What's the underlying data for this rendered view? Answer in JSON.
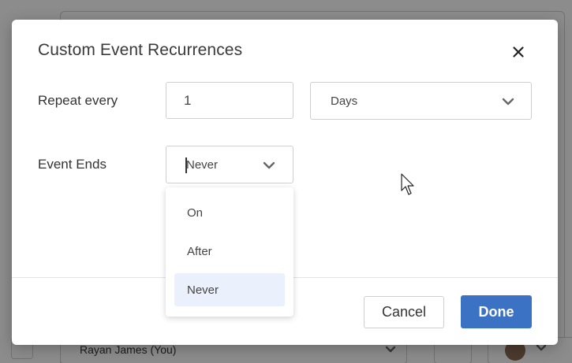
{
  "background": {
    "row_text": "Rayan James (You)"
  },
  "modal": {
    "title": "Custom Event Recurrences",
    "close_icon": "close-icon",
    "repeat_label": "Repeat every",
    "repeat_value": "1",
    "unit_value": "Days",
    "ends_label": "Event Ends",
    "ends_value": "Never",
    "ends_options": [
      "On",
      "After",
      "Never"
    ],
    "cancel_label": "Cancel",
    "done_label": "Done"
  },
  "colors": {
    "primary": "#3b72c4",
    "selected_option_bg": "#eaf1fc"
  }
}
